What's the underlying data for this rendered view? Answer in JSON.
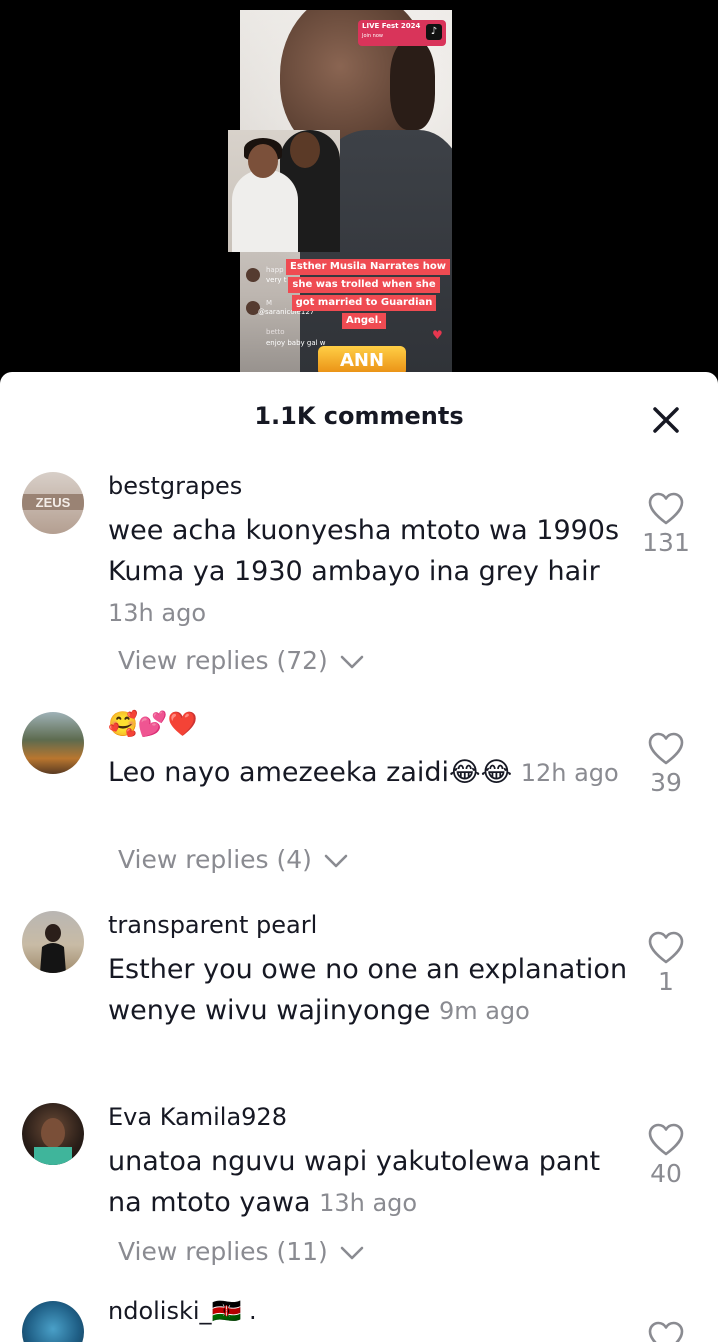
{
  "video": {
    "live_badge_title": "LIVE Fest 2024",
    "live_badge_sub": "Join now",
    "caption_lines": [
      "Esther Musila Narrates how",
      "she was trolled when she",
      "got married to Guardian",
      "Angel."
    ],
    "mini_comments": [
      {
        "name": "happ",
        "text": "very t"
      },
      {
        "name": "M",
        "text": "9"
      }
    ],
    "mini_handle": "@saranicole127",
    "mini_betto": "betto",
    "mini_enjoy": "enjoy baby gal w",
    "badge_text": "ANN"
  },
  "sheet": {
    "title": "1.1K comments",
    "close_icon": "close-icon"
  },
  "comments": [
    {
      "username": "bestgrapes",
      "text": "wee acha kuonyesha mtoto wa 1990s Kuma ya 1930 ambayo ina grey hair",
      "time": "13h ago",
      "likes": "131",
      "replies": "View replies (72)"
    },
    {
      "username": "🥰💕❤️",
      "text": "Leo nayo amezeeka zaidi😂😂",
      "time": "12h ago",
      "likes": "39",
      "replies": "View replies (4)"
    },
    {
      "username": "transparent pearl",
      "text": "Esther you owe no one an explanation wenye wivu wajinyonge",
      "time": "9m ago",
      "likes": "1",
      "replies": ""
    },
    {
      "username": "Eva Kamila928",
      "text": "unatoa nguvu wapi yakutolewa pant na mtoto yawa",
      "time": "13h ago",
      "likes": "40",
      "replies": "View replies (11)"
    },
    {
      "username": "ndoliski_🇰🇪 .",
      "text": "",
      "time": "",
      "likes": "",
      "replies": ""
    }
  ],
  "colors": {
    "sheet_bg": "#ffffff",
    "text_primary": "#161823",
    "text_secondary": "#8a8b91",
    "caption_bg": "#ef4b52"
  }
}
